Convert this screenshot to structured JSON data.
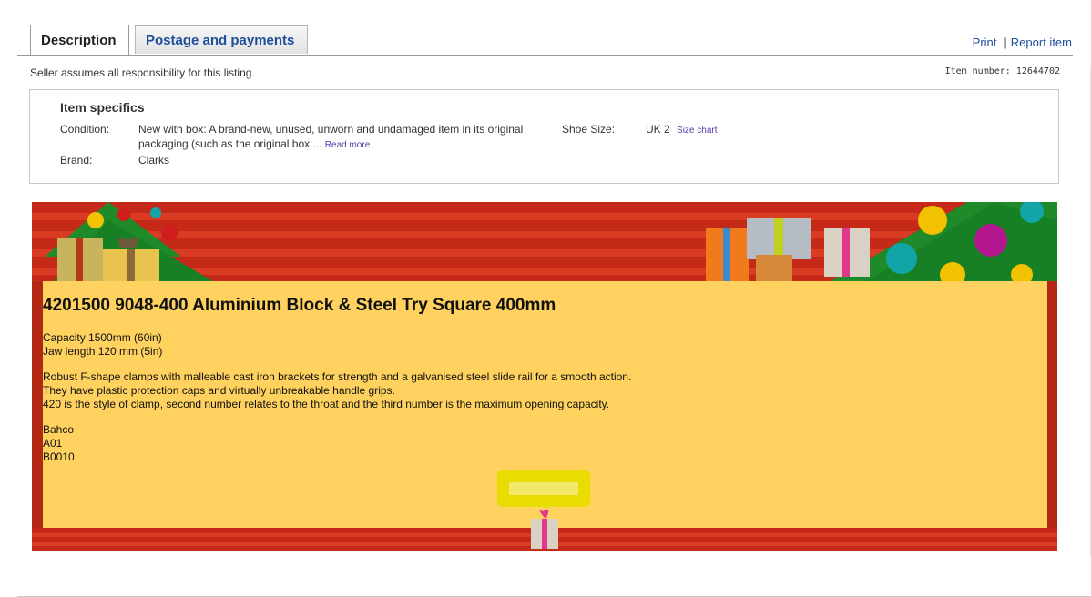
{
  "tabs": [
    {
      "label": "Description",
      "active": true
    },
    {
      "label": "Postage and payments",
      "active": false
    }
  ],
  "top_links": {
    "print": "Print",
    "separator": "|",
    "report": "Report item"
  },
  "disclaimer": "Seller assumes all responsibility for this listing.",
  "item_number": "Item number: 12644702",
  "item_specifics": {
    "title": "Item specifics",
    "condition_label": "Condition:",
    "condition_value": "New with box: A brand-new, unused, unworn and undamaged item in its original packaging (such as the original box ...",
    "read_more": "Read more",
    "brand_label": "Brand:",
    "brand_value": "Clarks",
    "shoe_size_label": "Shoe Size:",
    "shoe_size_value": "UK 2",
    "size_chart": "Size chart"
  },
  "listing": {
    "title": "4201500 9048-400 Aluminium Block & Steel Try Square 400mm",
    "specs": "Capacity 1500mm (60in)\nJaw length 120 mm (5in)",
    "description": "Robust F-shape clamps with malleable cast iron brackets for strength and a galvanised steel slide rail for a smooth action.\nThey have plastic protection caps and virtually unbreakable handle grips.\n420 is the style of clamp, second number relates to the throat and the third number is the maximum opening capacity.",
    "codes": "Bahco\nA01\nB0010"
  },
  "colors": {
    "link": "#1f4e9a",
    "banner_red": "#c52a18",
    "panel_yellow": "#ffd15e",
    "button_yellow": "#e8dc00"
  }
}
